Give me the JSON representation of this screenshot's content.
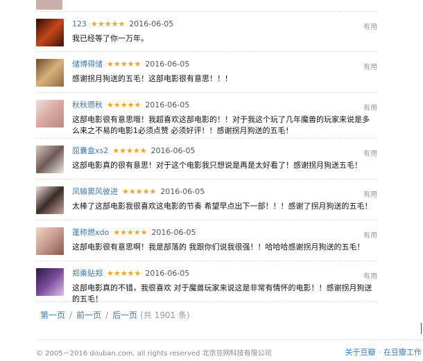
{
  "comments": [
    {
      "author": "123",
      "stars": "★★★★★",
      "date": "2016-06-05",
      "vote": "有用",
      "text": "我已经等了你一万年。",
      "avatar": "#8a2a10"
    },
    {
      "author": "储博得储",
      "stars": "★★★★★",
      "date": "2016-06-05",
      "vote": "有用",
      "text": "感谢拐月狗送的五毛！这部电影很有意思！！！",
      "avatar": "#a07a4a"
    },
    {
      "author": "秋秋瓒秋",
      "stars": "★★★★★",
      "date": "2016-06-05",
      "vote": "有用",
      "text": "这部电影很有意思哦！我超喜欢这部电影的！！对于我这个玩了几年魔兽的玩家来说是多么来之不易的电影1必须点赞 必须好评！！感谢拐月狗送的五毛！",
      "avatar": "#d9b7b0"
    },
    {
      "author": "屈囊盒xs2",
      "stars": "★★★★★",
      "date": "2016-06-05",
      "vote": "有用",
      "text": "这部电影真的很有意思！对于这个电影我只想说是再是太好看了！感谢拐月狗送五毛！",
      "avatar": "#6e5a57"
    },
    {
      "author": "凤输窦风彼进",
      "stars": "★★★★★",
      "date": "2016-06-05",
      "vote": "有用",
      "text": "太棒了这部电影我很喜欢这电影的节奏 希望早点出下一部！！！感谢了拐月狗送的五毛！",
      "avatar": "#3b2b29"
    },
    {
      "author": "蓬称燃xdo",
      "stars": "★★★★★",
      "date": "2016-06-05",
      "vote": "有用",
      "text": "这部电影很有意思啊！我是部落的 我跟你们说我很强！！哈哈哈感谢拐月狗送的五毛！",
      "avatar": "#c49a8c"
    },
    {
      "author": "郑乘贴郑",
      "stars": "★★★★★",
      "date": "2016-06-05",
      "vote": "有用",
      "text": "这部电影真的不错，我很喜欢 对于魔兽玩家来说这是非常有情怀的电影！！感谢拐月狗送的五毛！",
      "avatar": "#5b3c6e"
    }
  ],
  "pager": {
    "first": "第一页",
    "prev": "前一页",
    "next": "后一页",
    "total": "(共 1901 条)"
  },
  "footer": {
    "copyright": "© 2005－2016 douban.com, all rights reserved 北京豆网科技有限公司",
    "about": "关于豆瓣",
    "jobs": "在豆瓣工作"
  }
}
